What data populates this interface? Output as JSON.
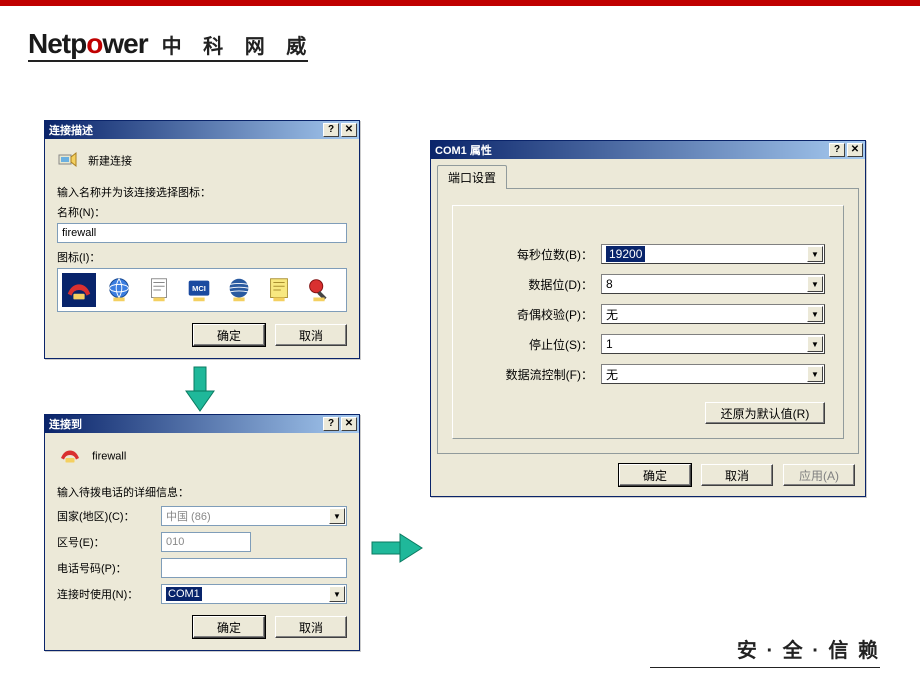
{
  "brand": {
    "net": "Netp",
    "o": "o",
    "wer": "wer",
    "cn": "中 科 网 威"
  },
  "footer": {
    "text": "安 · 全 · 信 赖"
  },
  "dialog1": {
    "title": "连接描述",
    "newConn": "新建连接",
    "prompt": "输入名称并为该连接选择图标：",
    "nameLabel": "名称(N)：",
    "nameValue": "firewall",
    "iconLabel": "图标(I)：",
    "ok": "确定",
    "cancel": "取消"
  },
  "dialog2": {
    "title": "连接到",
    "connName": "firewall",
    "prompt": "输入待拨电话的详细信息：",
    "countryLabel": "国家(地区)(C)：",
    "countryValue": "中国 (86)",
    "areaLabel": "区号(E)：",
    "areaValue": "010",
    "phoneLabel": "电话号码(P)：",
    "phoneValue": "",
    "connectUsingLabel": "连接时使用(N)：",
    "connectUsingValue": "COM1",
    "ok": "确定",
    "cancel": "取消"
  },
  "dialog3": {
    "title": "COM1 属性",
    "tab": "端口设置",
    "bpsLabel": "每秒位数(B)：",
    "bpsValue": "19200",
    "dataBitsLabel": "数据位(D)：",
    "dataBitsValue": "8",
    "parityLabel": "奇偶校验(P)：",
    "parityValue": "无",
    "stopBitsLabel": "停止位(S)：",
    "stopBitsValue": "1",
    "flowLabel": "数据流控制(F)：",
    "flowValue": "无",
    "restore": "还原为默认值(R)",
    "ok": "确定",
    "cancel": "取消",
    "apply": "应用(A)"
  },
  "colors": {
    "titlebar_start": "#0a246a",
    "titlebar_end": "#a6caf0",
    "dialog_bg": "#ece9d8",
    "brand_red": "#c00000",
    "arrow_green": "#1fb89a"
  }
}
